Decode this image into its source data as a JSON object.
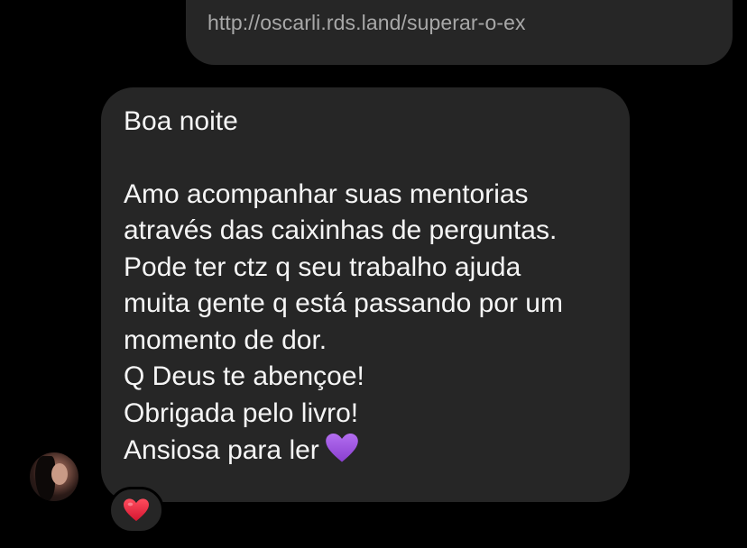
{
  "outgoing_message": {
    "link": "http://oscarli.rds.land/superar-o-ex"
  },
  "incoming_message": {
    "greeting": "Boa noite",
    "lines": [
      "Amo acompanhar suas mentorias",
      "através das caixinhas de perguntas.",
      "Pode ter ctz q seu trabalho ajuda",
      "muita gente q está passando por um",
      "momento de dor.",
      "Q Deus te abençoe!",
      "Obrigada pelo livro!",
      "Ansiosa para ler"
    ],
    "trailing_emoji": "purple-heart-icon",
    "reaction": "red-heart-icon"
  },
  "colors": {
    "background": "#000000",
    "bubble": "#262626",
    "message_text": "#f5f5f5",
    "link_text": "#a8a8a8",
    "purple_heart": "#9b4dd8",
    "red_heart": "#e0203a"
  }
}
